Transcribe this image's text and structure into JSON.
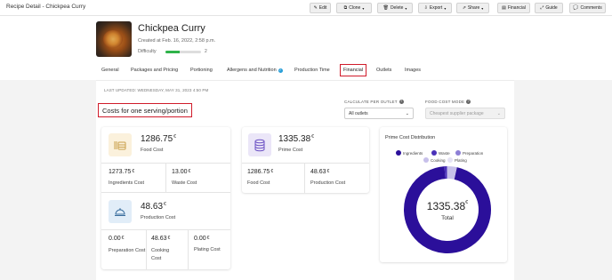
{
  "page_title": "Recipe Detail - Chickpea Curry",
  "toolbar": {
    "edit": "Edit",
    "clone": "Clone",
    "delete": "Delete",
    "export": "Export",
    "share": "Share",
    "financial": "Financial",
    "guide": "Guide",
    "comments": "Comments"
  },
  "recipe": {
    "name": "Chickpea Curry",
    "created": "Created at Feb. 16, 2022, 2:58 p.m.",
    "difficulty_label": "Difficulty",
    "difficulty_value": "2",
    "difficulty_fraction": 0.4
  },
  "tabs": [
    "General",
    "Packages and Pricing",
    "Portioning",
    "Allergens and Nutrition",
    "Production Time",
    "Financial",
    "Outlets",
    "Images"
  ],
  "active_tab": "Financial",
  "last_updated": "LAST UPDATED: WEDNESDAY, MAY 31, 2023 4:50 PM",
  "section_title": "Costs for one serving/portion",
  "calculate_per_outlet": {
    "label": "CALCULATE PER OUTLET",
    "value": "All outlets"
  },
  "food_cost_mode": {
    "label": "FOOD COST MODE",
    "value": "Cheapest supplier package"
  },
  "currency": "€",
  "food_cost_card": {
    "value": "1286.75",
    "label": "Food Cost",
    "ingredients_value": "1273.75",
    "ingredients_label": "Ingredients Cost",
    "waste_value": "13.00",
    "waste_label": "Waste Cost"
  },
  "production_cost_card": {
    "value": "48.63",
    "label": "Production Cost",
    "preparation_value": "0.00",
    "preparation_label": "Preparation Cost",
    "cooking_value": "48.63",
    "cooking_label": "Cooking Cost",
    "plating_value": "0.00",
    "plating_label": "Plating Cost"
  },
  "prime_cost_card": {
    "value": "1335.38",
    "label": "Prime Cost",
    "food_value": "1286.75",
    "food_label": "Food Cost",
    "production_value": "48.63",
    "production_label": "Production Cost"
  },
  "distribution": {
    "title": "Prime Cost Distribution",
    "total_value": "1335.38",
    "total_label": "Total"
  },
  "chart_data": {
    "type": "pie",
    "donut": true,
    "series": [
      {
        "name": "Ingredients",
        "value": 1273.75,
        "color": "#2b0f9a"
      },
      {
        "name": "Waste",
        "value": 13.0,
        "color": "#4a31b8"
      },
      {
        "name": "Preparation",
        "value": 0.0,
        "color": "#8d7fd6"
      },
      {
        "name": "Cooking",
        "value": 48.63,
        "color": "#c7c0ea"
      },
      {
        "name": "Plating",
        "value": 0.0,
        "color": "#e6e3f5"
      }
    ],
    "legend": "top"
  }
}
